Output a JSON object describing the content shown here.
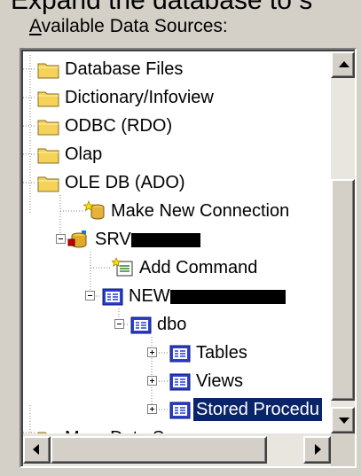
{
  "caption": "Expand the database to s",
  "panel": {
    "label_hotkey": "A",
    "label_rest": "vailable Data Sources:"
  },
  "tree": {
    "items": [
      {
        "label": "Database Files",
        "icon": "folder-icon"
      },
      {
        "label": "Dictionary/Infoview",
        "icon": "folder-icon"
      },
      {
        "label": "ODBC (RDO)",
        "icon": "folder-icon"
      },
      {
        "label": "Olap",
        "icon": "folder-icon"
      },
      {
        "label": "OLE DB (ADO)",
        "icon": "folder-icon"
      },
      {
        "label": "Make New Connection",
        "icon": "new-connection-icon"
      },
      {
        "label": "SRV",
        "icon": "server-icon"
      },
      {
        "label": "Add Command",
        "icon": "add-command-icon"
      },
      {
        "label": "NEW",
        "icon": "database-icon"
      },
      {
        "label": "dbo",
        "icon": "schema-icon"
      },
      {
        "label": "Tables",
        "icon": "tables-icon"
      },
      {
        "label": "Views",
        "icon": "views-icon"
      },
      {
        "label": "Stored Procedu",
        "icon": "stored-procedures-icon",
        "selected": true
      },
      {
        "label": "More Data Sources",
        "icon": "folder-icon"
      }
    ]
  },
  "colors": {
    "selection": "#0a246a",
    "folder": "#f5d35a",
    "panel": "#d4d0c8"
  }
}
